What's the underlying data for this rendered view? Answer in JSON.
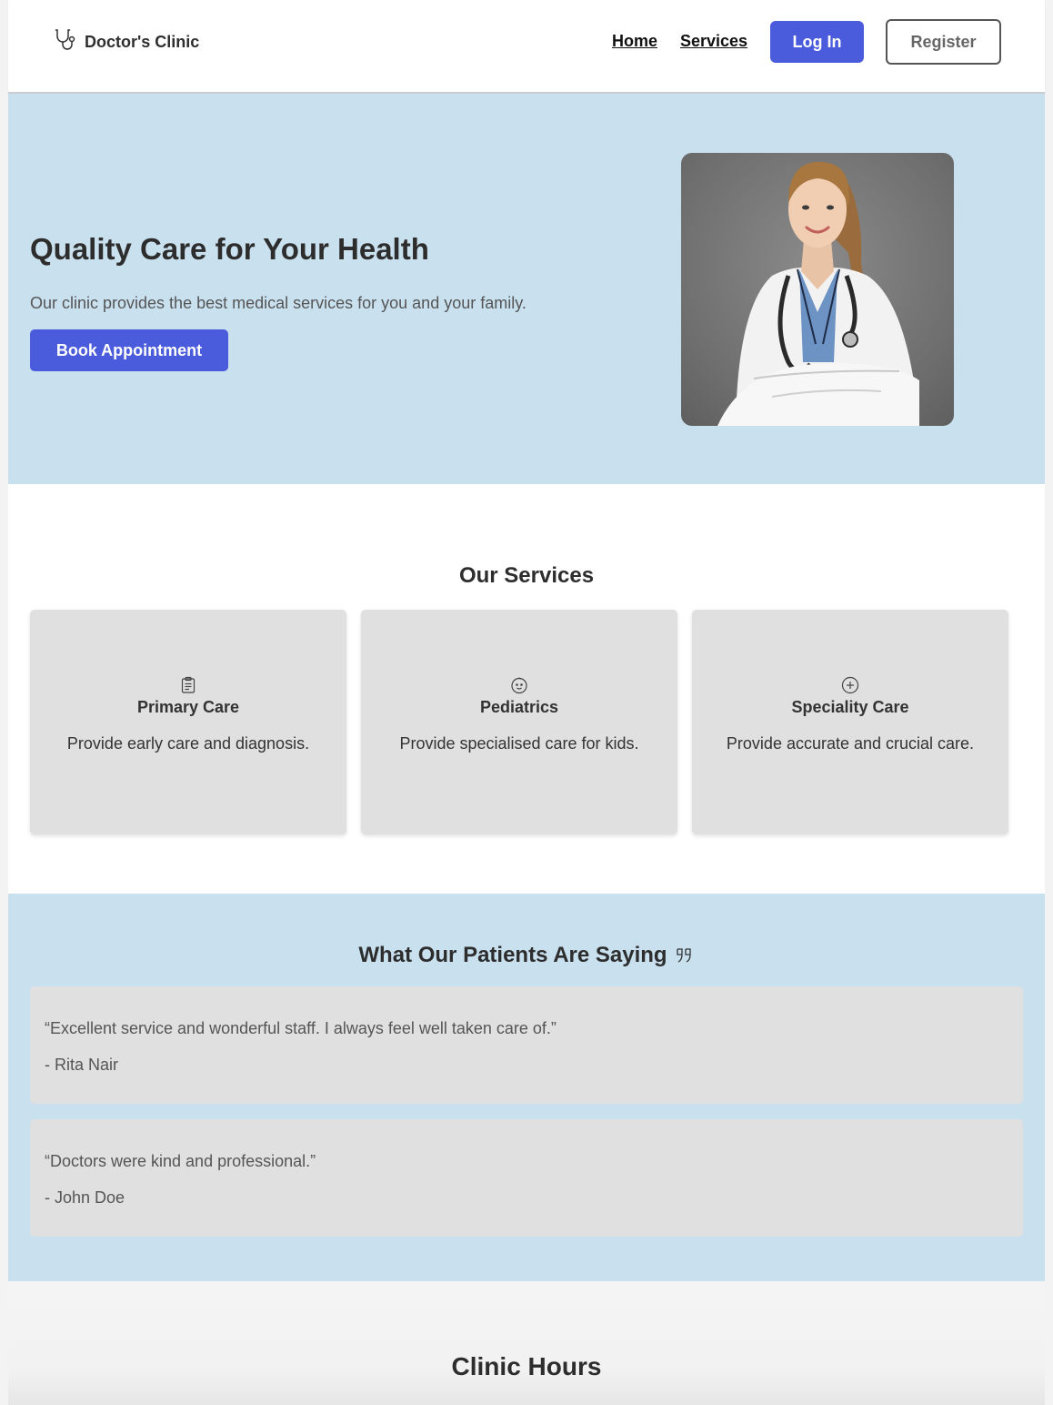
{
  "header": {
    "brand_name": "Doctor's Clinic",
    "brand_icon": "stethoscope-icon",
    "nav": {
      "home": "Home",
      "services": "Services"
    },
    "login_label": "Log In",
    "register_label": "Register"
  },
  "hero": {
    "title": "Quality Care for Your Health",
    "subtitle": "Our clinic provides the best medical services for you and your family.",
    "cta_label": "Book Appointment"
  },
  "services": {
    "title": "Our Services",
    "items": [
      {
        "icon": "clipboard-icon",
        "title": "Primary Care",
        "description": "Provide early care and diagnosis."
      },
      {
        "icon": "baby-face-icon",
        "title": "Pediatrics",
        "description": "Provide specialised care for kids."
      },
      {
        "icon": "plus-circle-icon",
        "title": "Speciality Care",
        "description": "Provide accurate and crucial care."
      }
    ]
  },
  "testimonials": {
    "title": "What Our Patients Are Saying",
    "items": [
      {
        "quote": "“Excellent service and wonderful staff. I always feel well taken care of.”",
        "author": "- Rita Nair"
      },
      {
        "quote": "“Doctors were kind and professional.”",
        "author": "- John Doe"
      }
    ]
  },
  "hours": {
    "title": "Clinic Hours"
  },
  "colors": {
    "accent": "#4a5bdc",
    "hero_bg": "#c9e1ef",
    "card_bg": "#e0e0e0"
  }
}
